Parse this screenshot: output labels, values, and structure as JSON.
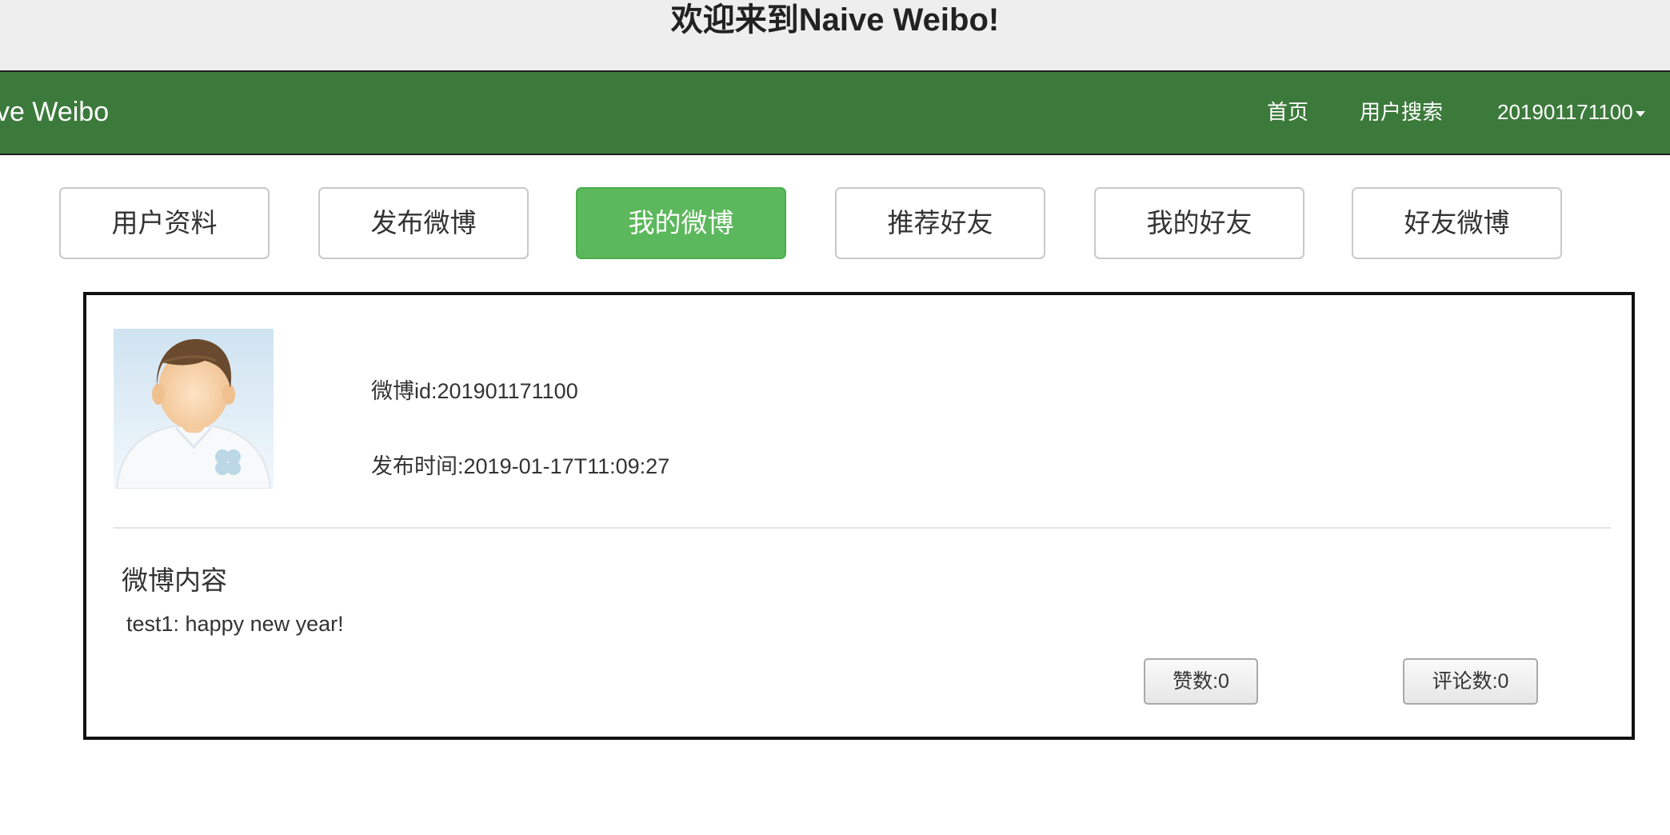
{
  "banner": {
    "title": "欢迎来到Naive Weibo!"
  },
  "navbar": {
    "brand": "Naive Weibo",
    "links": [
      {
        "label": "首页"
      },
      {
        "label": "用户搜索"
      }
    ],
    "user_menu": "201901171100"
  },
  "tabs": [
    {
      "label": "用户资料",
      "active": false
    },
    {
      "label": "发布微博",
      "active": false
    },
    {
      "label": "我的微博",
      "active": true
    },
    {
      "label": "推荐好友",
      "active": false
    },
    {
      "label": "我的好友",
      "active": false
    },
    {
      "label": "好友微博",
      "active": false
    }
  ],
  "post": {
    "weibo_id_label": "微博id:",
    "weibo_id": "201901171100",
    "time_label": "发布时间:",
    "time": "2019-01-17T11:09:27",
    "content_heading": "微博内容",
    "content_text": "test1: happy new year!",
    "like_label": "赞数:",
    "like_count": "0",
    "comment_label": "评论数:",
    "comment_count": "0"
  },
  "colors": {
    "navbar": "#3c7a3c",
    "active_tab": "#5cb85c"
  }
}
